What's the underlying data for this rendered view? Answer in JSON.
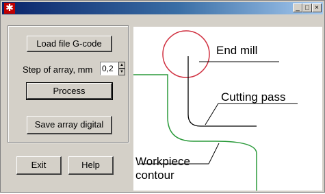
{
  "window": {
    "app_icon": "star-emblem-icon",
    "minimize_label": "_",
    "maximize_label": "□",
    "close_label": "×"
  },
  "controls": {
    "load_button": "Load file G-code",
    "step_label": "Step of array, mm",
    "step_value": "0,2",
    "process_button": "Process",
    "save_button": "Save array digital",
    "exit_button": "Exit",
    "help_button": "Help"
  },
  "diagram": {
    "end_mill_label": "End mill",
    "cutting_pass_label": "Cutting pass",
    "workpiece_label_line1": "Workpiece",
    "workpiece_label_line2": "contour",
    "colors": {
      "tool_circle": "#d03040",
      "workpiece_contour": "#2a9a3a",
      "cutting_pass": "#000000"
    }
  }
}
